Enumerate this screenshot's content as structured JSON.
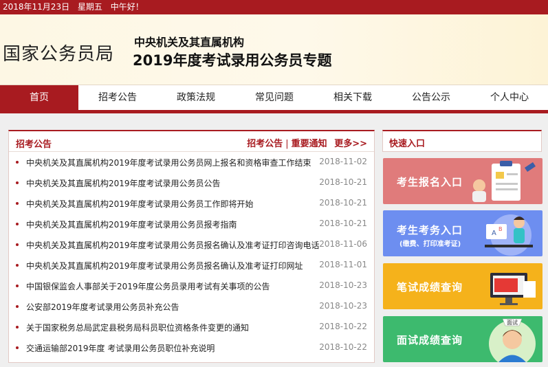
{
  "topbar": {
    "date": "2018年11月23日",
    "weekday": "星期五",
    "greeting": "中午好！"
  },
  "header": {
    "logo": "国家公务员局",
    "subtitle1": "中央机关及其直属机构",
    "subtitle2": "2019年度考试录用公务员专题"
  },
  "nav": {
    "items": [
      "首页",
      "招考公告",
      "政策法规",
      "常见问题",
      "相关下载",
      "公告公示",
      "个人中心"
    ]
  },
  "notice_panel": {
    "title": "招考公告",
    "link1": "招考公告",
    "link2": "重要通知",
    "more": "更多>>",
    "items": [
      {
        "title": "中央机关及其直属机构2019年度考试录用公务员网上报名和资格审查工作结束",
        "date": "2018-11-02"
      },
      {
        "title": "中央机关及其直属机构2019年度考试录用公务员公告",
        "date": "2018-10-21"
      },
      {
        "title": "中央机关及其直属机构2019年度考试录用公务员工作即将开始",
        "date": "2018-10-21"
      },
      {
        "title": "中央机关及其直属机构2019年度考试录用公务员报考指南",
        "date": "2018-10-21"
      },
      {
        "title": "中央机关及其直属机构2019年度考试录用公务员报名确认及准考证打印咨询电话",
        "date": "2018-11-06"
      },
      {
        "title": "中央机关及其直属机构2019年度考试录用公务员报名确认及准考证打印网址",
        "date": "2018-11-01"
      },
      {
        "title": "中国银保监会人事部关于2019年度公务员录用考试有关事项的公告",
        "date": "2018-10-23"
      },
      {
        "title": "公安部2019年度考试录用公务员补充公告",
        "date": "2018-10-23"
      },
      {
        "title": "关于国家税务总局武定县税务局科员职位资格条件变更的通知",
        "date": "2018-10-22"
      },
      {
        "title": "交通运输部2019年度 考试录用公务员职位补充说明",
        "date": "2018-10-22"
      }
    ]
  },
  "quick_entry": {
    "title": "快速入口",
    "tiles": [
      {
        "label": "考生报名入口",
        "sub": "",
        "color": "#e07b7b",
        "icon": "clipboard-icon"
      },
      {
        "label": "考生考务入口",
        "sub": "(缴费、打印准考证)",
        "color": "#6d8ef0",
        "icon": "student-computer-icon"
      },
      {
        "label": "笔试成绩查询",
        "sub": "",
        "color": "#f5b21b",
        "icon": "monitor-book-icon"
      },
      {
        "label": "面试成绩查询",
        "sub": "",
        "color": "#3dba6e",
        "icon": "interview-person-icon"
      }
    ],
    "badge": "面试"
  }
}
